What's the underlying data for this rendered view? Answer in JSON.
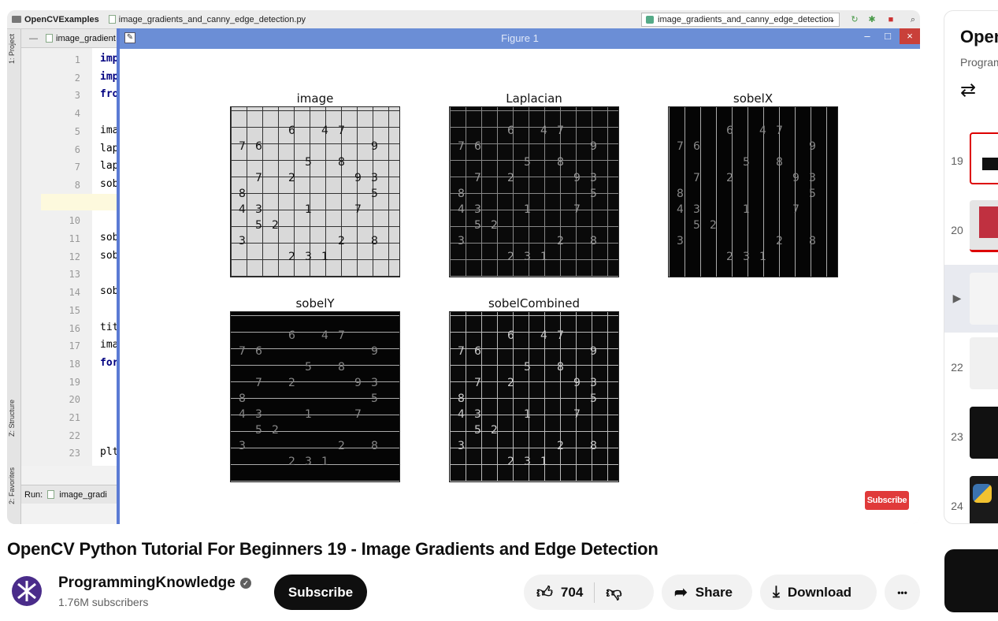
{
  "ide": {
    "project": "OpenCVExamples",
    "file": "image_gradients_and_canny_edge_detection.py",
    "run_config": "image_gradients_and_canny_edge_detection",
    "tab": "image_gradient",
    "side_project": "1: Project",
    "side_structure": "Z: Structure",
    "side_favorites": "2: Favorites",
    "run_label": "Run:",
    "run_tab": "image_gradi",
    "line_numbers": [
      "1",
      "2",
      "3",
      "4",
      "5",
      "6",
      "7",
      "8",
      "9",
      "10",
      "11",
      "12",
      "13",
      "14",
      "15",
      "16",
      "17",
      "18",
      "19",
      "20",
      "21",
      "22",
      "23"
    ],
    "code_lines": [
      "imp",
      "imp",
      "fro",
      "",
      "ima",
      "lap",
      "lap",
      "sob",
      "sob",
      "",
      "sob",
      "sob",
      "",
      "sob",
      "",
      "tit",
      "ima",
      "for",
      "",
      "",
      "",
      "",
      "plt"
    ]
  },
  "figure": {
    "window_title": "Figure 1",
    "minimize": "–",
    "maximize": "□",
    "close": "×",
    "plots": [
      {
        "title": "image"
      },
      {
        "title": "Laplacian"
      },
      {
        "title": "sobelX"
      },
      {
        "title": "sobelY"
      },
      {
        "title": "sobelCombined"
      }
    ],
    "sudoku_digits": [
      "6",
      "4",
      "7",
      "7",
      "6",
      "9",
      "5",
      "8",
      "7",
      "2",
      "9",
      "3",
      "8",
      "5",
      "4",
      "3",
      "1",
      "7",
      "5",
      "2",
      "3",
      "2",
      "8",
      "2",
      "3",
      "1"
    ],
    "watermark": "Subscribe"
  },
  "playlist": {
    "title": "Open",
    "subtitle": "Program",
    "items": [
      {
        "num": "19"
      },
      {
        "num": "20"
      },
      {
        "num": "▶"
      },
      {
        "num": "22"
      },
      {
        "num": "23"
      },
      {
        "num": "24"
      }
    ]
  },
  "video": {
    "title": "OpenCV Python Tutorial For Beginners 19 - Image Gradients and Edge Detection",
    "channel": "ProgrammingKnowledge",
    "subscribers": "1.76M subscribers",
    "subscribe_label": "Subscribe",
    "likes": "704",
    "share_label": "Share",
    "download_label": "Download",
    "more_label": "•••"
  },
  "colors": {
    "accent_blue": "#6b8ed6",
    "subscribe_red": "#e03a3a"
  }
}
